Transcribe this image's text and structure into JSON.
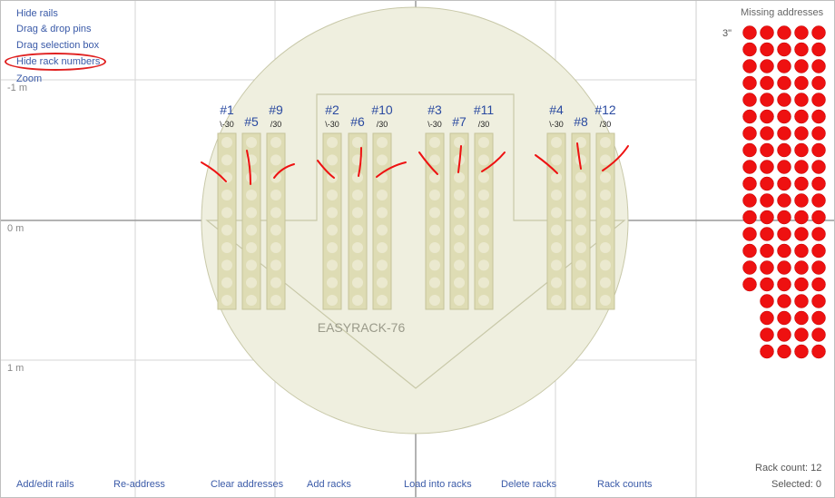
{
  "menu": {
    "items": [
      {
        "id": "hide-rails",
        "label": "Hide rails"
      },
      {
        "id": "drag-drop-pins",
        "label": "Drag & drop pins"
      },
      {
        "id": "drag-selection-box",
        "label": "Drag selection box"
      },
      {
        "id": "hide-rack-numbers",
        "label": "Hide rack numbers"
      },
      {
        "id": "zoom",
        "label": "Zoom"
      }
    ]
  },
  "axis": {
    "labels": [
      "-1 m",
      "0 m",
      "1 m"
    ]
  },
  "plate": {
    "name": "EASYRACK-76",
    "fill": "#efefdf",
    "stroke": "#c8c8a8"
  },
  "racks": [
    {
      "number": "#1",
      "sub": "\\-30"
    },
    {
      "number": "#5",
      "sub": ""
    },
    {
      "number": "#9",
      "sub": "/30"
    },
    {
      "number": "#2",
      "sub": "\\-30"
    },
    {
      "number": "#6",
      "sub": ""
    },
    {
      "number": "#10",
      "sub": "/30"
    },
    {
      "number": "#3",
      "sub": "\\-30"
    },
    {
      "number": "#7",
      "sub": ""
    },
    {
      "number": "#11",
      "sub": "/30"
    },
    {
      "number": "#4",
      "sub": "\\-30"
    },
    {
      "number": "#8",
      "sub": ""
    },
    {
      "number": "#12",
      "sub": "/30"
    }
  ],
  "rack_style": {
    "fill": "#dedcb4",
    "stroke": "#c6c39a",
    "hole": "#ebe9cf",
    "holes_per_rack": 10
  },
  "missing_addresses": {
    "title": "Missing addresses",
    "size_label": "3\"",
    "dot_color": "#ee1111",
    "rows": [
      5,
      5,
      5,
      5,
      5,
      5,
      5,
      5,
      5,
      5,
      5,
      5,
      5,
      5,
      5,
      5,
      4,
      4,
      4,
      4
    ]
  },
  "toolbar": {
    "buttons": [
      {
        "id": "add-edit-rails",
        "label": "Add/edit rails"
      },
      {
        "id": "re-address",
        "label": "Re-address"
      },
      {
        "id": "clear-addresses",
        "label": "Clear addresses"
      },
      {
        "id": "add-racks",
        "label": "Add racks"
      },
      {
        "id": "load-into-racks",
        "label": "Load into racks"
      },
      {
        "id": "delete-racks",
        "label": "Delete racks"
      },
      {
        "id": "rack-counts",
        "label": "Rack counts"
      }
    ]
  },
  "stats": {
    "rack_count": "Rack count: 12",
    "selected": "Selected: 0"
  },
  "colors": {
    "link": "#3a5aa8",
    "rack_number": "#2a4aa0",
    "annotation": "#ee1111",
    "grid": "#d6d6d6",
    "axis": "#9a9a9a"
  }
}
